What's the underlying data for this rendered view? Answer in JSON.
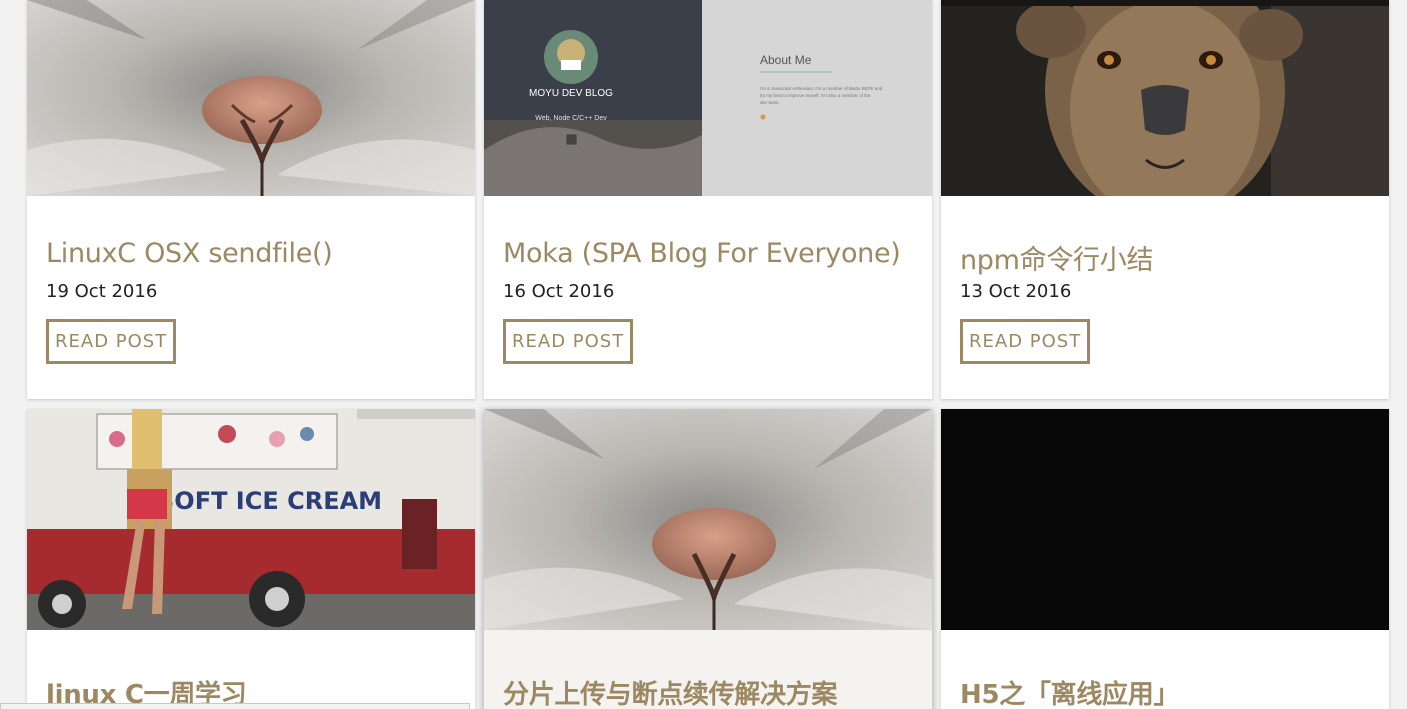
{
  "posts": [
    {
      "title": "LinuxC OSX sendfile()",
      "date": "19 Oct 2016",
      "button": "READ POST"
    },
    {
      "title": "Moka (SPA Blog For Everyone)",
      "date": "16 Oct 2016",
      "button": "READ POST"
    },
    {
      "title": "npm命令行小结",
      "date": "13 Oct 2016",
      "button": "READ POST"
    },
    {
      "title": "linux C一周学习"
    },
    {
      "title": "分片上传与断点续传解决方案"
    },
    {
      "title": "H5之「离线应用」"
    }
  ],
  "moka_preview": {
    "blog_name": "MOYU DEV BLOG",
    "tagline": "Web, Node C/C++ Dev",
    "about_title": "About Me",
    "about_text_1": "I'm a Javascript enthusiast. I'm a member of Baidu BEFE and",
    "about_text_2": "try my best to improve myself. I'm also a member of the",
    "about_text_3": "dev team."
  },
  "truck_sign": "SOFT ICE CREAM",
  "colors": {
    "accent": "#9c8862",
    "background": "#f2f2f2"
  }
}
